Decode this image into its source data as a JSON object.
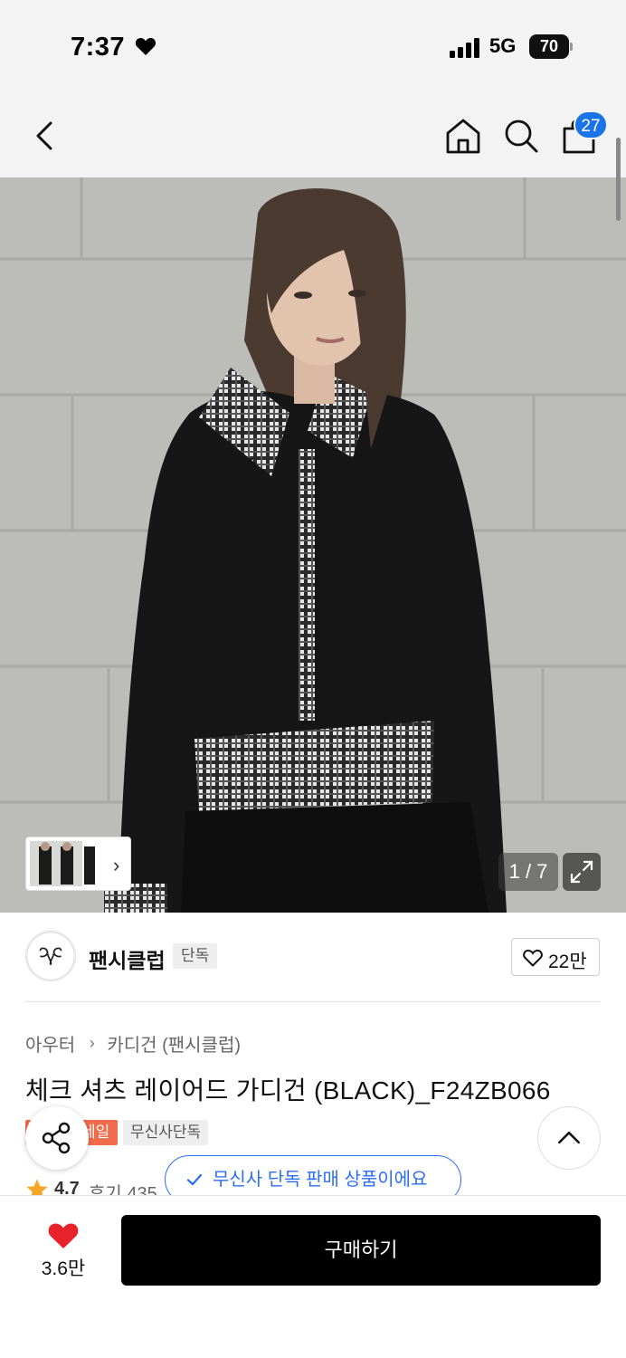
{
  "status_bar": {
    "time": "7:37",
    "network": "5G",
    "battery": "70"
  },
  "header": {
    "back_icon": "chevron-left-icon",
    "home_icon": "home-icon",
    "search_icon": "search-icon",
    "cart_icon": "shopping-bag-icon",
    "cart_count": "27"
  },
  "gallery": {
    "page_counter": "1 / 7",
    "expand_icon": "expand-icon",
    "thumbnails_icon": "chevron-right-icon"
  },
  "brand": {
    "name": "팬시클럽",
    "tag": "단독",
    "likes": "22만",
    "logo_icon": "brand-logo-icon"
  },
  "product": {
    "breadcrumb": [
      "아우터",
      "카디건 (팬시클럽)"
    ],
    "title": "체크 셔츠 레이어드 가디건 (BLACK)_F24ZB066",
    "badges": {
      "sale": "세일",
      "exclusive": "무신사단독"
    },
    "rating": "4.7",
    "review_label": "후기 435"
  },
  "toast": {
    "message": "무신사 단독 판매 상품이에요"
  },
  "bottom_bar": {
    "wish_count": "3.6만",
    "buy_label": "구매하기"
  },
  "colors": {
    "accent_blue": "#2d6ef5",
    "sale_red": "#f06a4b",
    "wish_red": "#e8222a",
    "buy_black": "#000000"
  }
}
